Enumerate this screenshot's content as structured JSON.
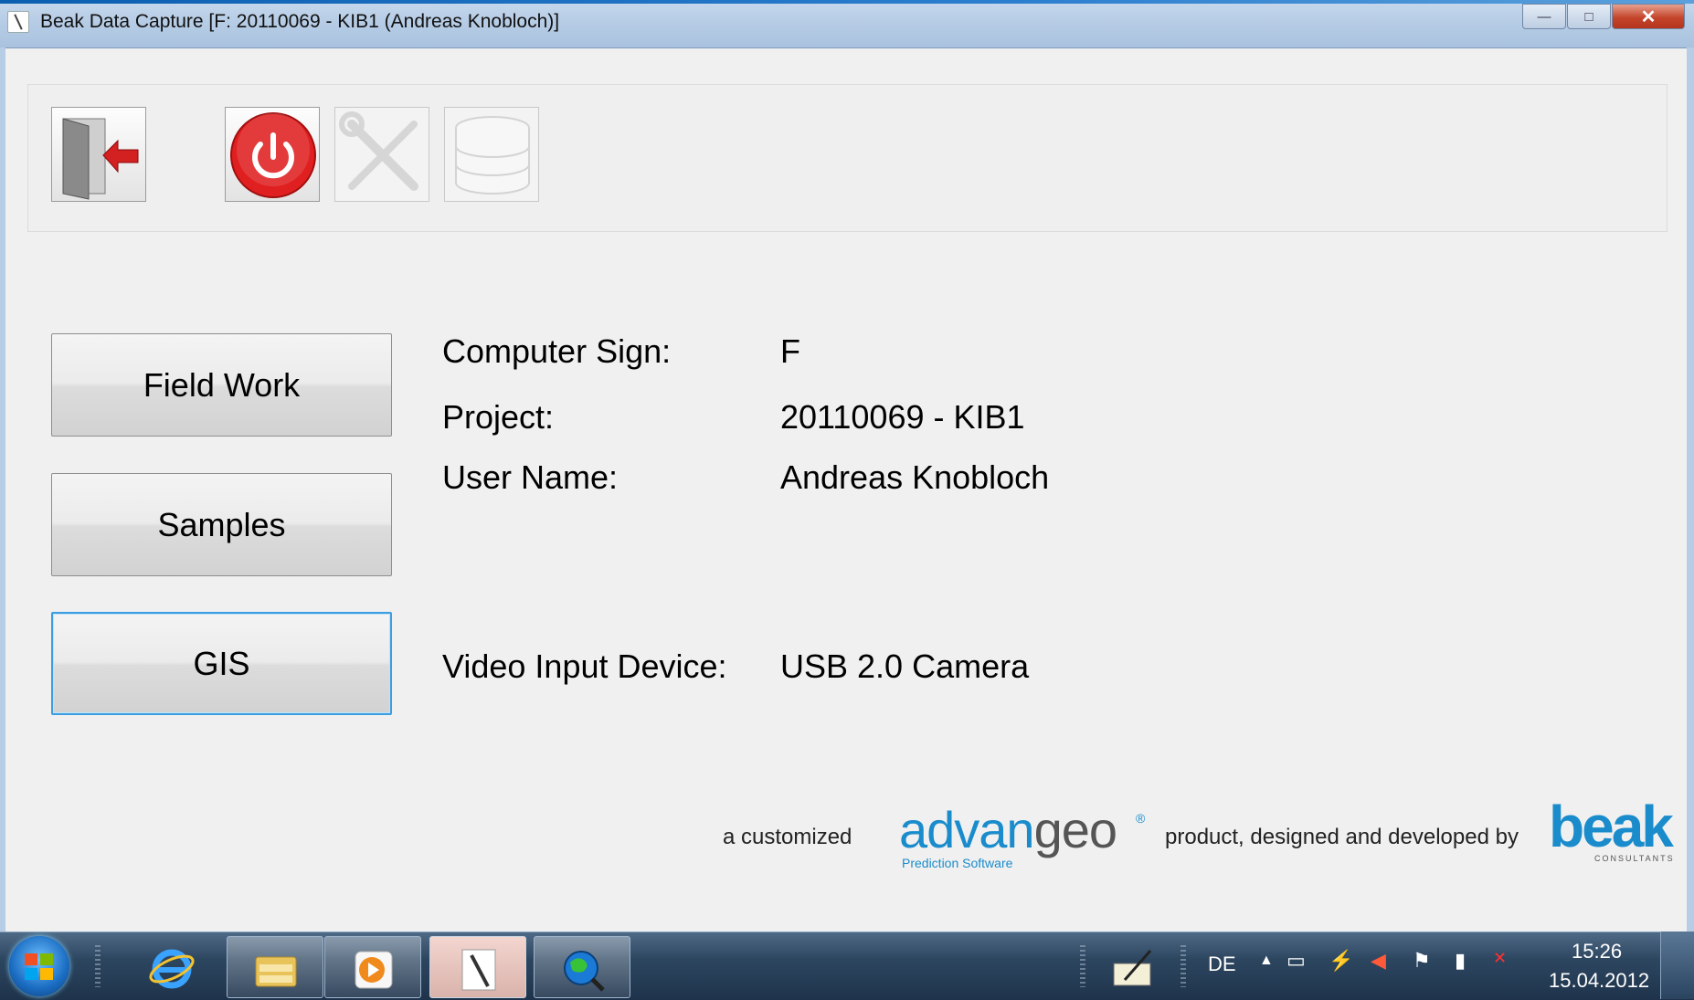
{
  "window": {
    "title": "Beak Data Capture [F: 20110069 - KIB1 (Andreas Knobloch)]",
    "controls": {
      "minimize": "—",
      "maximize": "□",
      "close": "✕"
    }
  },
  "toolbar": {
    "buttons": [
      {
        "name": "exit",
        "icon": "exit-door-icon",
        "enabled": true
      },
      {
        "name": "power",
        "icon": "power-icon",
        "enabled": true
      },
      {
        "name": "tools",
        "icon": "wrench-screwdriver-icon",
        "enabled": false
      },
      {
        "name": "database",
        "icon": "database-icon",
        "enabled": false
      }
    ]
  },
  "nav": {
    "field_work": "Field Work",
    "samples": "Samples",
    "gis": "GIS"
  },
  "info": {
    "computer_sign_label": "Computer Sign:",
    "computer_sign_value": "F",
    "project_label": "Project:",
    "project_value": "20110069 - KIB1",
    "user_name_label": "User Name:",
    "user_name_value": "Andreas Knobloch",
    "video_input_label": "Video Input Device:",
    "video_input_value": "USB 2.0 Camera"
  },
  "footer": {
    "prefix": "a customized",
    "advangeo_brand_a": "advan",
    "advangeo_brand_b": "geo",
    "advangeo_reg": "®",
    "advangeo_sub": "Prediction Software",
    "middle": "product, designed and developed by",
    "beak_brand": "beak",
    "beak_sub": "CONSULTANTS"
  },
  "taskbar": {
    "language": "DE",
    "time": "15:26",
    "date": "15.04.2012",
    "items": [
      "ie-icon",
      "explorer-icon",
      "media-player-icon",
      "beak-app-icon",
      "globe-search-icon"
    ]
  },
  "colors": {
    "accent_blue": "#1a8ccc",
    "power_red": "#e02020",
    "focus_border": "#3c9ee0"
  }
}
